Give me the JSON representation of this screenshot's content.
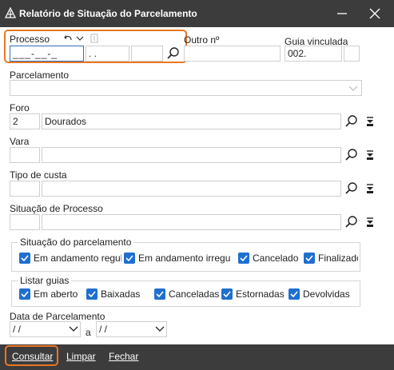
{
  "window": {
    "title": "Relatório de Situação do Parcelamento"
  },
  "processo": {
    "label": "Processo",
    "numero": "___-__-_",
    "seg2": ". .",
    "seg3": ""
  },
  "outro_numero": {
    "label": "Outro nº",
    "value": ""
  },
  "guia_vinculada": {
    "label": "Guia vinculada",
    "value": "002."
  },
  "parcelamento": {
    "label": "Parcelamento",
    "value": ""
  },
  "foro": {
    "label": "Foro",
    "codigo": "2",
    "nome": "Dourados"
  },
  "vara": {
    "label": "Vara",
    "codigo": "",
    "nome": ""
  },
  "tipo_custa": {
    "label": "Tipo de custa",
    "codigo": "",
    "nome": ""
  },
  "situacao_processo": {
    "label": "Situação de Processo",
    "codigo": "",
    "nome": ""
  },
  "situacao_parcelamento": {
    "title": "Situação do parcelamento",
    "options": [
      {
        "label": "Em andamento regular",
        "checked": true
      },
      {
        "label": "Em andamento irregular",
        "checked": true
      },
      {
        "label": "Cancelado",
        "checked": true
      },
      {
        "label": "Finalizado",
        "checked": true
      }
    ]
  },
  "listar_guias": {
    "title": "Listar guias",
    "options": [
      {
        "label": "Em aberto",
        "checked": true
      },
      {
        "label": "Baixadas",
        "checked": true
      },
      {
        "label": "Canceladas",
        "checked": true
      },
      {
        "label": "Estornadas",
        "checked": true
      },
      {
        "label": "Devolvidas",
        "checked": true
      }
    ]
  },
  "data_parcelamento": {
    "label": "Data de Parcelamento",
    "from": " / /",
    "separator": "a",
    "to": " / /"
  },
  "footer": {
    "consultar": "Consultar",
    "limpar": "Limpar",
    "fechar": "Fechar"
  },
  "colors": {
    "titlebar": "#3c3c3c",
    "checkbox": "#1f6fd0",
    "highlight": "#e87722"
  }
}
